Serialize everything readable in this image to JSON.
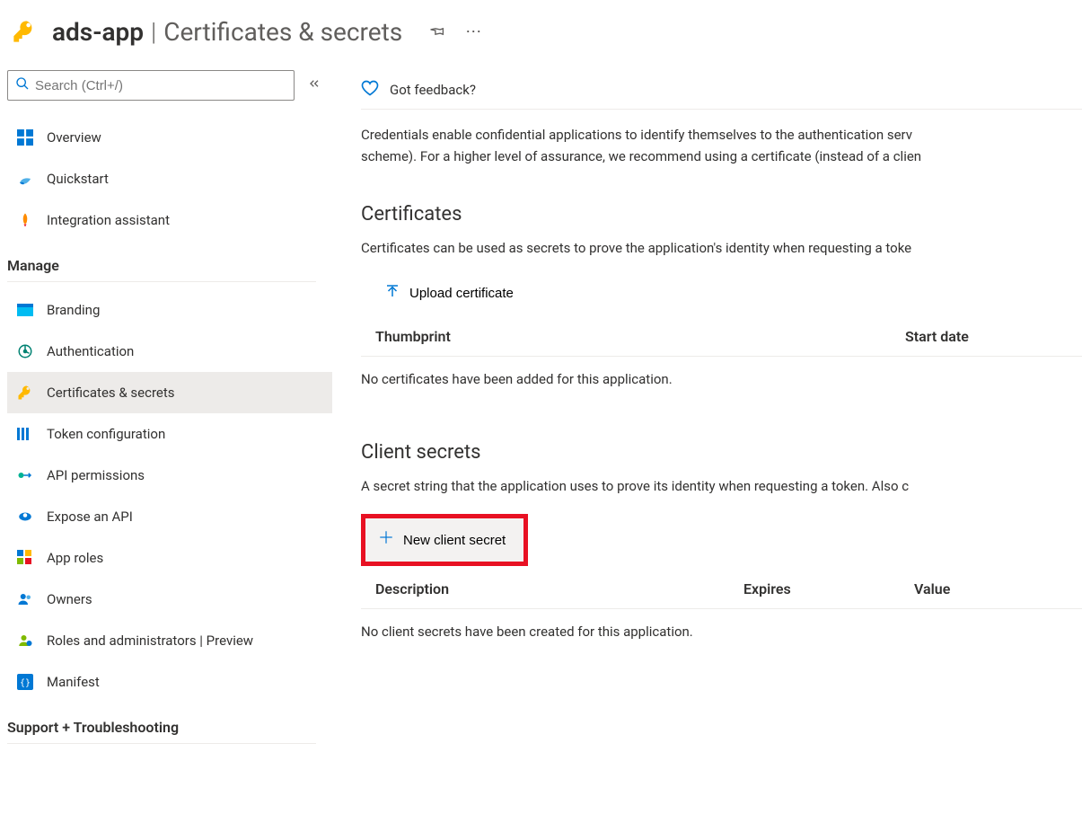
{
  "header": {
    "app_name": "ads-app",
    "separator": "|",
    "page_title": "Certificates & secrets"
  },
  "search": {
    "placeholder": "Search (Ctrl+/)"
  },
  "sidebar": {
    "top": [
      {
        "label": "Overview",
        "icon": "overview"
      },
      {
        "label": "Quickstart",
        "icon": "quickstart"
      },
      {
        "label": "Integration assistant",
        "icon": "rocket"
      }
    ],
    "manage_header": "Manage",
    "manage": [
      {
        "label": "Branding",
        "icon": "branding"
      },
      {
        "label": "Authentication",
        "icon": "auth"
      },
      {
        "label": "Certificates & secrets",
        "icon": "key",
        "selected": true
      },
      {
        "label": "Token configuration",
        "icon": "token"
      },
      {
        "label": "API permissions",
        "icon": "apiperm"
      },
      {
        "label": "Expose an API",
        "icon": "expose"
      },
      {
        "label": "App roles",
        "icon": "approles"
      },
      {
        "label": "Owners",
        "icon": "owners"
      },
      {
        "label": "Roles and administrators | Preview",
        "icon": "roles"
      },
      {
        "label": "Manifest",
        "icon": "manifest"
      }
    ],
    "support_header": "Support + Troubleshooting"
  },
  "toolbar": {
    "feedback": "Got feedback?"
  },
  "main": {
    "intro_line1": "Credentials enable confidential applications to identify themselves to the authentication serv",
    "intro_line2": "scheme). For a higher level of assurance, we recommend using a certificate (instead of a clien",
    "certificates": {
      "title": "Certificates",
      "desc": "Certificates can be used as secrets to prove the application's identity when requesting a toke",
      "upload_label": "Upload certificate",
      "col_thumb": "Thumbprint",
      "col_start": "Start date",
      "empty": "No certificates have been added for this application."
    },
    "secrets": {
      "title": "Client secrets",
      "desc": "A secret string that the application uses to prove its identity when requesting a token. Also c",
      "new_label": "New client secret",
      "col_desc": "Description",
      "col_exp": "Expires",
      "col_val": "Value",
      "empty": "No client secrets have been created for this application."
    }
  }
}
